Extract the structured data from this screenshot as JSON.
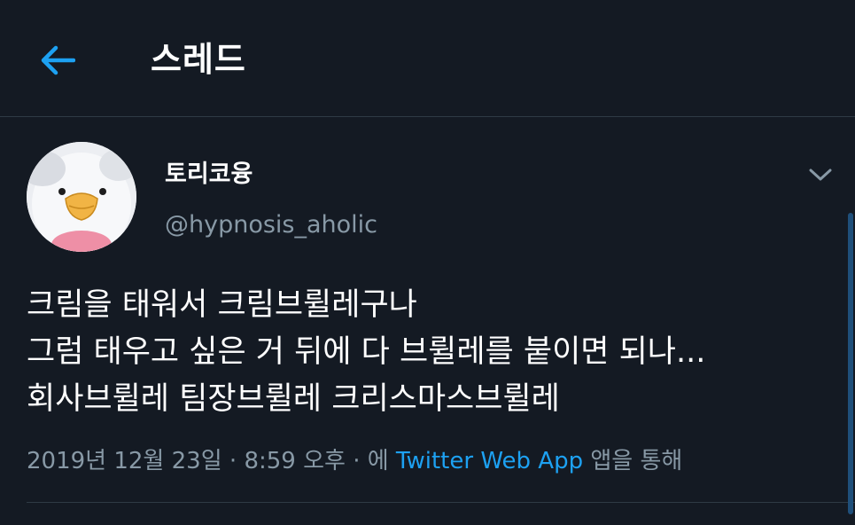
{
  "header": {
    "title": "스레드"
  },
  "tweet": {
    "display_name": "토리코융",
    "handle": "@hypnosis_aholic",
    "text_lines": [
      "크림을 태워서 크림브륄레구나",
      "그럼 태우고 싶은 거 뒤에 다 브륄레를 붙이면 되나...",
      "회사브륄레 팀장브륄레 크리스마스브륄레"
    ],
    "date": "2019년 12월 23일",
    "time": "8:59 오후",
    "separator": "·",
    "via_prefix": "에",
    "source": "Twitter Web App",
    "via_suffix": "앱을 통해"
  },
  "icons": {
    "back": "arrow-left-icon",
    "caret": "chevron-down-icon"
  },
  "colors": {
    "background": "#141a23",
    "accent": "#1da1f2",
    "secondary_text": "#8899a6",
    "divider": "#2f3a45"
  }
}
